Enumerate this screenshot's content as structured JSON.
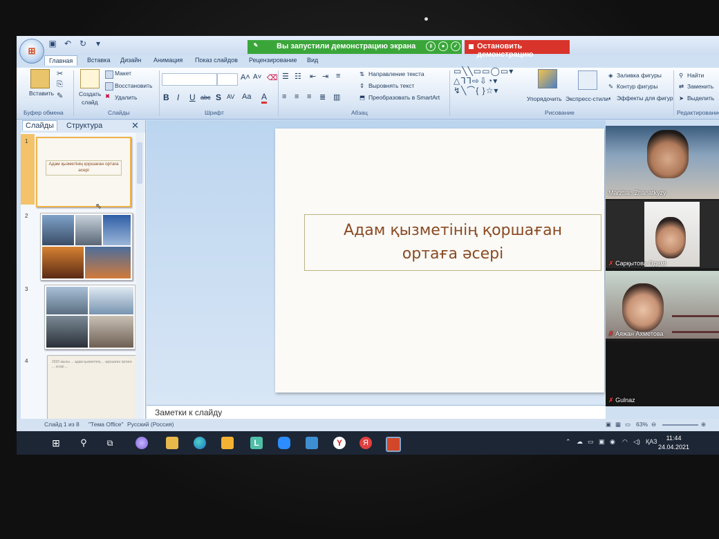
{
  "titlebar": {
    "share_banner": "Вы запустили демонстрацию экрана",
    "stop_button": "Остановить демонстрацию"
  },
  "tabs": [
    "Главная",
    "Вставка",
    "Дизайн",
    "Анимация",
    "Показ слайдов",
    "Рецензирование",
    "Вид"
  ],
  "ribbon": {
    "clipboard": {
      "paste": "Вставить",
      "group": "Буфер обмена"
    },
    "slides": {
      "create": "Создать",
      "create2": "слайд",
      "layout": "Макет",
      "reset": "Восстановить",
      "delete": "Удалить",
      "group": "Слайды"
    },
    "font": {
      "group": "Шрифт"
    },
    "paragraph": {
      "text_direction": "Направление текста",
      "align_text": "Выровнять текст",
      "smartart": "Преобразовать в SmartArt",
      "group": "Абзац"
    },
    "drawing": {
      "arrange": "Упорядочить",
      "quick_styles": "Экспресс-стили",
      "shape_fill": "Заливка фигуры",
      "shape_outline": "Контур фигуры",
      "shape_effects": "Эффекты для фигур",
      "group": "Рисование"
    },
    "editing": {
      "find": "Найти",
      "replace": "Заменить",
      "select": "Выделить",
      "group": "Редактирование"
    }
  },
  "panel": {
    "tab_slides": "Слайды",
    "tab_outline": "Структура",
    "close": "✕",
    "thumbs": [
      {
        "num": "1",
        "text": "Адам қызметінің қоршаған ортаға әсері"
      },
      {
        "num": "2"
      },
      {
        "num": "3"
      },
      {
        "num": "4",
        "text": "2020 жылы ... адам қызметінің ... қоршаған ортаға ... әсері ..."
      }
    ]
  },
  "slide": {
    "title_line1": "Адам қызметінің қоршаған",
    "title_line2": "ортаға әсері"
  },
  "notes": {
    "placeholder": "Заметки к слайду"
  },
  "participants": [
    {
      "name": "Marzhan Zhanatkyzy"
    },
    {
      "name": "Сарқытова Әдемі"
    },
    {
      "name": "Аяжан Ахметова"
    },
    {
      "name": "Gulnaz"
    }
  ],
  "status": {
    "slide_info": "Слайд 1 из 8",
    "theme": "\"Тема Office\"",
    "language": "Русский (Россия)",
    "zoom": "63%"
  },
  "taskbar": {
    "language": "ҚАЗ",
    "time": "11:44",
    "date": "24.04.2021"
  },
  "colors": {
    "title_text": "#8a4a22",
    "share_banner": "#3aa63a",
    "stop_button": "#d9342b"
  }
}
